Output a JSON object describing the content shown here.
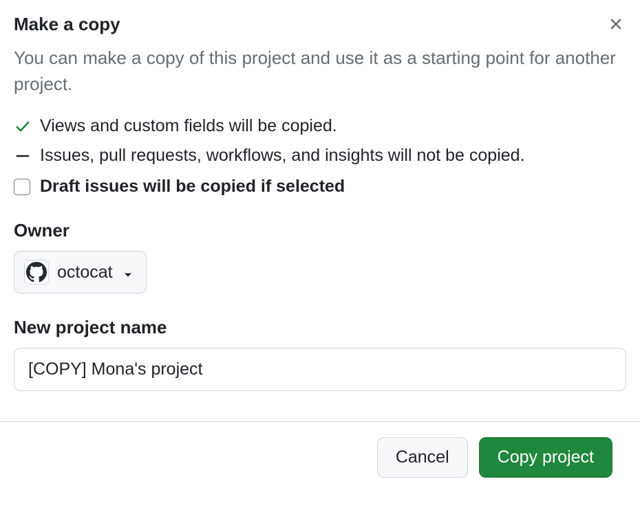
{
  "dialog": {
    "title": "Make a copy",
    "description": "You can make a copy of this project and use it as a starting point for another project.",
    "info_copied": "Views and custom fields will be copied.",
    "info_not_copied": "Issues, pull requests, workflows, and insights will not be copied.",
    "draft_checkbox_label": "Draft issues will be copied if selected",
    "draft_checkbox_checked": false
  },
  "owner": {
    "label": "Owner",
    "selected": "octocat"
  },
  "project_name": {
    "label": "New project name",
    "value": "[COPY] Mona's project"
  },
  "footer": {
    "cancel": "Cancel",
    "submit": "Copy project"
  }
}
